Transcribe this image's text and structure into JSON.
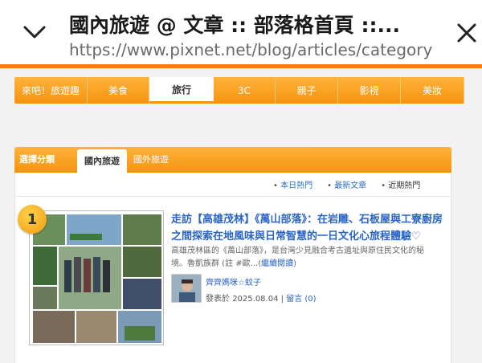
{
  "browser": {
    "title": "國內旅遊 @ 文章 :: 部落格首頁 ::...",
    "url": "https://www.pixnet.net/blog/articles/category",
    "back_icon": "chevron-down-icon",
    "close_icon": "close-icon"
  },
  "category_nav": {
    "items": [
      {
        "label": "來吧！旅遊趣",
        "active": false
      },
      {
        "label": "美食",
        "active": false
      },
      {
        "label": "旅行",
        "active": true
      },
      {
        "label": "3C",
        "active": false
      },
      {
        "label": "親子",
        "active": false
      },
      {
        "label": "影視",
        "active": false
      },
      {
        "label": "美妝",
        "active": false
      }
    ]
  },
  "panel": {
    "select_label": "選擇分類",
    "tabs": [
      {
        "label": "國內旅遊",
        "active": true
      },
      {
        "label": "國外旅遊",
        "active": false
      }
    ],
    "sort": {
      "today": "本日熱門",
      "latest": "最新文章",
      "recent": "近期熱門"
    }
  },
  "articles": [
    {
      "rank": "1",
      "title": "走訪【高雄茂林】《萬山部落》：在岩雕、石板屋與工寮廚房之間探索在地風味與日常智慧的一日文化心旅程體驗♡",
      "excerpt": "高雄茂林區的《萬山部落》，是台灣少見融合考古遺址與原住民文化的秘境。魯凱族群 (註 #歐...",
      "read_more": "繼續閱讀",
      "author": "齊齊媽咪☆蚊子",
      "posted_prefix": "發表於",
      "date": "2025.08.04",
      "separator": "|",
      "comments_label": "留言",
      "comments_count": "(0)"
    }
  ],
  "colors": {
    "accent_orange": "#f49410",
    "link_blue": "#2a64c5"
  }
}
